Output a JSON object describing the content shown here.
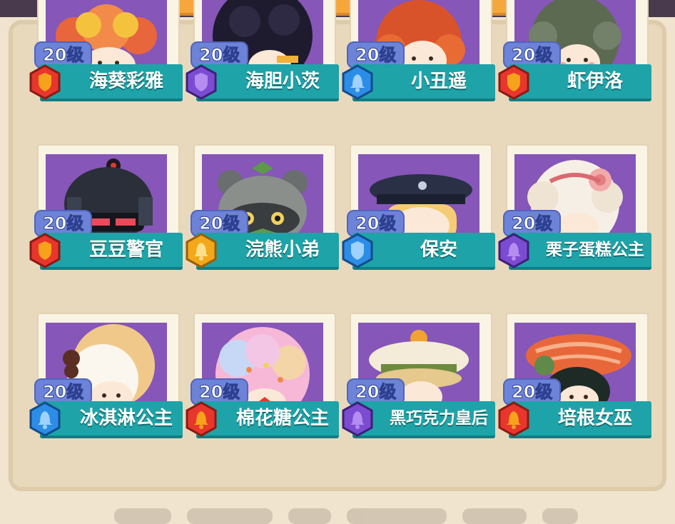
{
  "colors": {
    "portrait_bg": "#8656b8",
    "name_bar": "#1ea3a8",
    "level_tag": "#6d83d8",
    "rarity": {
      "red": "#e8362c",
      "purple": "#7b4cd1",
      "blue": "#2c8de6",
      "gold": "#f2a81a"
    }
  },
  "cards": [
    {
      "level": "20级",
      "name": "海葵彩雅",
      "rarity": "red",
      "icon": "shield-icon"
    },
    {
      "level": "20级",
      "name": "海胆小茨",
      "rarity": "purple",
      "icon": "shield-icon"
    },
    {
      "level": "20级",
      "name": "小丑遥",
      "rarity": "blue",
      "icon": "bell-icon"
    },
    {
      "level": "20级",
      "name": "虾伊洛",
      "rarity": "red",
      "icon": "shield-icon"
    },
    {
      "level": "20级",
      "name": "豆豆警官",
      "rarity": "red",
      "icon": "shield-icon"
    },
    {
      "level": "20级",
      "name": "浣熊小弟",
      "rarity": "gold",
      "icon": "bell-icon"
    },
    {
      "level": "20级",
      "name": "保安",
      "rarity": "blue",
      "icon": "shield-icon"
    },
    {
      "level": "20级",
      "name": "栗子蛋糕公主",
      "rarity": "purple",
      "icon": "bell-icon"
    },
    {
      "level": "20级",
      "name": "冰淇淋公主",
      "rarity": "blue",
      "icon": "bell-icon"
    },
    {
      "level": "20级",
      "name": "棉花糖公主",
      "rarity": "red",
      "icon": "bell-icon"
    },
    {
      "level": "20级",
      "name": "黑巧克力皇后",
      "rarity": "purple",
      "icon": "bell-icon"
    },
    {
      "level": "20级",
      "name": "培根女巫",
      "rarity": "red",
      "icon": "bell-icon"
    }
  ]
}
